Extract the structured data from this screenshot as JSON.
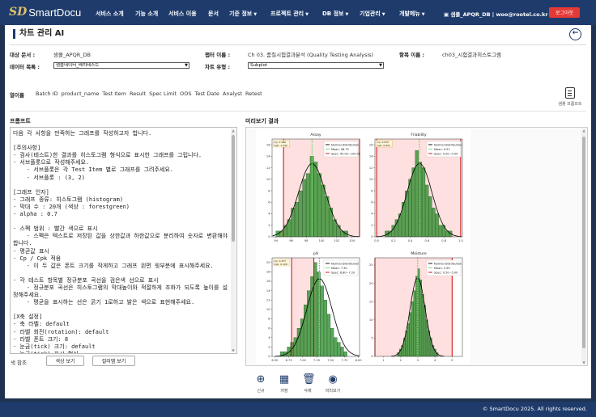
{
  "header": {
    "logo_mark": "SD",
    "logo_text": "SmartDocu",
    "menu": [
      {
        "label": "서비스 소개",
        "caret": false
      },
      {
        "label": "기능 소개",
        "caret": false
      },
      {
        "label": "서비스 이용",
        "caret": false
      },
      {
        "label": "문서",
        "caret": false
      },
      {
        "label": "기준 정보",
        "caret": true
      },
      {
        "label": "프로젝트 관리",
        "caret": true
      },
      {
        "label": "DB 정보",
        "caret": true
      },
      {
        "label": "기업관리",
        "caret": true
      },
      {
        "label": "개발메뉴",
        "caret": true
      }
    ],
    "user": "샘플_APQR_DB | woo@rootel.co.kr",
    "logout": "로그아웃"
  },
  "page": {
    "title": "차트 관리 AI",
    "back_icon": "back-arrow-icon"
  },
  "meta": {
    "target_doc_label": "대상 문서 :",
    "target_doc_value": "샘플_APQR_DB",
    "chapter_label": "챕터 이름 :",
    "chapter_value": "Ch 03. 품질시험결과분석 (Quality Testing Analysis)",
    "item_label": "항목 이름 :",
    "item_value": "ch03_시험결과히스토그램",
    "datalist_label": "데이터 목록 :",
    "datalist_value": "샘플데이터_배치테스트",
    "charttype_label": "차트 유형 :",
    "charttype_value": "Subplot"
  },
  "columns": {
    "label": "열이름",
    "items": [
      "Batch ID",
      "product_name",
      "Test Item",
      "Result",
      "Spec Limit",
      "OOS",
      "Test Date",
      "Analyst",
      "Retest"
    ]
  },
  "sample_prompt": "샘플 프롬프트",
  "prompt": {
    "title": "프롬프트",
    "text": "다음 각 사항을 만족하는 그래프를 작성하고자 합니다.\n\n[주의사항]\n- 검사(테스트)한 결과를 히스토그램 형식으로 표시한 그래프를 그립니다.\n- 서브플롯으로 작성해주세요.\n    - 서브플롯은 각 Test Item 별로 그래프를 그려주세요.\n    - 서브플롯 : (3, 2)\n\n[그래프 인자]\n- 그래프 종류: 히스토그램 (histogram)\n- 막대 수 : 20개 (색상 : forestgreen)\n- alpha : 0.7\n\n- 스펙 범위 : 빨간 색으로 표시\n    - 스펙은 텍스트로 저장된 값을 상한값과 하한값으로 분리하여 숫자로 변환해야 합니다.\n- 평균값 표시\n- Cp / Cpk 적용\n    - 이 두 값은 폰트 크기를 작게하고 그래프 왼편 윗부분에 표시해주세요.\n\n- 각 테스트 항목별 정규분포 곡선을 검은색 선으로 표시\n    - 정규분포 곡선은 히스토그램의 막대높이와 적절하게 조화가 되도록 높이를 설정해주세요.\n    - 평균을 표시하는 선은 굵기 1로하고 밝은 색으로 표현해주세요.\n\n[X축 설정]\n- 축 라벨: default\n- 라벨 회전(rotation): default\n- 라벨 폰트 크기: 8\n- 눈금(tick) 크기: default\n- 눈금(tick) 표시 형식"
  },
  "colors_label": "색 참조",
  "buttons": {
    "color_view": "색상 보기",
    "colormap_view": "컬러맵 보기"
  },
  "preview_title": "미리보기 결과",
  "toolbar": [
    {
      "label": "신규",
      "icon": "add-icon"
    },
    {
      "label": "저장",
      "icon": "save-icon"
    },
    {
      "label": "삭제",
      "icon": "trash-icon"
    },
    {
      "label": "미리보기",
      "icon": "preview-icon"
    }
  ],
  "footer": "© SmartDocu 2025. All rights reserved.",
  "colors": {
    "nav": "#1e3b6b",
    "logout": "#e53935",
    "bars": "#228b22",
    "spec": "#cc0000",
    "mean": "#66dd66"
  },
  "chart_data": [
    {
      "type": "bar",
      "title": "Assay",
      "xticks": [
        "94",
        "96",
        "98",
        "100",
        "102",
        "104"
      ],
      "yticks": [
        "0",
        "2",
        "4",
        "6",
        "8",
        "10",
        "12",
        "14",
        "16"
      ],
      "ylim": [
        0,
        17
      ],
      "xlim": [
        93.5,
        105
      ],
      "cp_text": "Cp: 1.586\nCpk: 1.549",
      "legend": [
        "Normal Distribution",
        "Mean: 98.75",
        "Spec: 95.00~105.00"
      ],
      "mean": 98.75,
      "spec": [
        95,
        105
      ],
      "bins": [
        94.0,
        94.5,
        95.0,
        95.5,
        96.0,
        96.5,
        97.0,
        97.5,
        98.0,
        98.5,
        99.0,
        99.5,
        100.0,
        100.5,
        101.0,
        101.5,
        102.0,
        102.5,
        103.0,
        103.5
      ],
      "values": [
        1,
        1,
        2,
        3,
        5,
        6,
        8,
        10,
        11,
        14,
        13,
        11,
        9,
        7,
        5,
        3,
        2,
        1,
        1,
        0
      ]
    },
    {
      "type": "bar",
      "title": "Friability",
      "xticks": [
        "0.0",
        "0.2",
        "0.4",
        "0.6",
        "0.8",
        "1.0"
      ],
      "yticks": [
        "0",
        "2",
        "4",
        "6",
        "8",
        "10",
        "12",
        "14",
        "16"
      ],
      "ylim": [
        0,
        17
      ],
      "xlim": [
        -0.02,
        1.02
      ],
      "cp_text": "Cp: 0.870\nCpk: 0.843",
      "legend": [
        "Normal Distribution",
        "Mean: 0.51",
        "Spec: 0.00~0.00"
      ],
      "mean": 0.51,
      "spec": [
        0.0,
        1.0
      ],
      "bins": [
        0.1,
        0.14,
        0.18,
        0.22,
        0.26,
        0.3,
        0.34,
        0.38,
        0.42,
        0.46,
        0.5,
        0.54,
        0.58,
        0.62,
        0.66,
        0.7,
        0.74,
        0.78,
        0.82,
        0.86
      ],
      "values": [
        1,
        1,
        2,
        3,
        4,
        6,
        8,
        10,
        12,
        15,
        13,
        12,
        9,
        7,
        5,
        4,
        2,
        2,
        1,
        1
      ]
    },
    {
      "type": "bar",
      "title": "pH",
      "xticks": [
        "6.50",
        "6.75",
        "7.00",
        "7.25",
        "7.50",
        "7.75",
        "8.00"
      ],
      "yticks": [
        "0",
        "2",
        "4",
        "6",
        "8",
        "10",
        "12",
        "14",
        "16",
        "18",
        "20"
      ],
      "ylim": [
        0,
        21
      ],
      "xlim": [
        6.45,
        8.02
      ],
      "cp_text": "Cp: 0.257\nCpk: 0.109",
      "legend": [
        "Normal Distribution",
        "Mean: 7.30",
        "Spec: 6.80~7.20"
      ],
      "mean": 7.3,
      "spec": [
        6.8,
        7.2
      ],
      "bins": [
        6.6,
        6.66,
        6.72,
        6.78,
        6.84,
        6.9,
        6.96,
        7.02,
        7.08,
        7.14,
        7.2,
        7.26,
        7.32,
        7.38,
        7.44,
        7.5,
        7.56,
        7.62,
        7.68,
        7.74
      ],
      "values": [
        1,
        1,
        2,
        3,
        4,
        6,
        8,
        11,
        14,
        17,
        20,
        18,
        15,
        12,
        9,
        6,
        4,
        3,
        2,
        1
      ]
    },
    {
      "type": "bar",
      "title": "Moisture",
      "xticks": [
        "1",
        "2",
        "3",
        "4",
        "5"
      ],
      "yticks": [
        "0",
        "5",
        "10",
        "15",
        "20",
        "25"
      ],
      "ylim": [
        0,
        27
      ],
      "xlim": [
        0.5,
        5.6
      ],
      "cp_text": "",
      "legend": [
        "Normal Distribution",
        "Mean: 2.99",
        "Spec: 0.50~5.00"
      ],
      "mean": 2.99,
      "spec": [
        0.5,
        5.0
      ],
      "bins": [
        1.8,
        1.92,
        2.04,
        2.16,
        2.28,
        2.4,
        2.52,
        2.64,
        2.76,
        2.88,
        3.0,
        3.12,
        3.24,
        3.36,
        3.48,
        3.6,
        3.72,
        3.84,
        3.96,
        4.08
      ],
      "values": [
        1,
        2,
        3,
        5,
        7,
        9,
        12,
        15,
        18,
        22,
        24,
        21,
        17,
        14,
        10,
        7,
        5,
        3,
        2,
        1
      ]
    }
  ]
}
